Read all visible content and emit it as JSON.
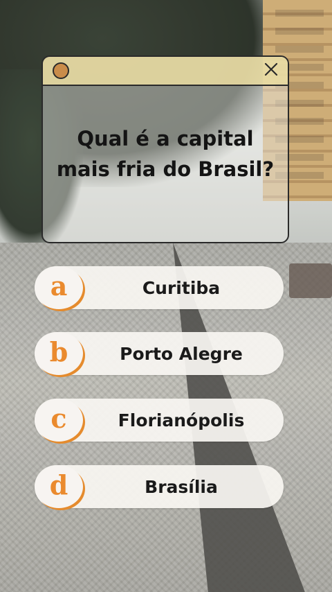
{
  "quiz": {
    "question_line1": "Qual é a capital",
    "question_line2": "mais fria do Brasil?",
    "options": [
      {
        "letter": "a",
        "label": "Curitiba"
      },
      {
        "letter": "b",
        "label": "Porto Alegre"
      },
      {
        "letter": "c",
        "label": "Florianópolis"
      },
      {
        "letter": "d",
        "label": "Brasília"
      }
    ]
  },
  "window": {
    "left_icon": "circle-icon",
    "right_icon": "close-icon"
  },
  "colors": {
    "titlebar": "#e8dba0",
    "accent": "#ea8a2e",
    "text": "#141414"
  }
}
